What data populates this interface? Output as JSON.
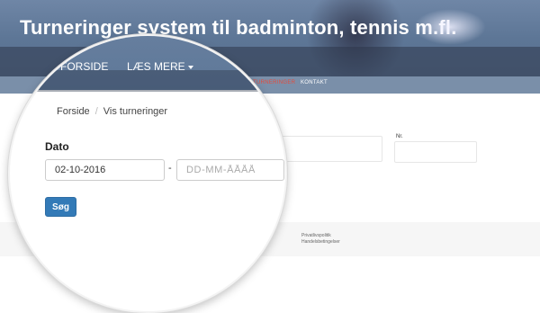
{
  "header": {
    "title": "Turneringer system til badminton, tennis m.fl."
  },
  "nav": {
    "items": [
      "FORSIDE",
      "LÆS MERE"
    ]
  },
  "subnav": {
    "items": [
      "TURNERINGER",
      "KONTAKT"
    ]
  },
  "breadcrumb": {
    "home": "Forside",
    "current": "Vis turneringer"
  },
  "form": {
    "date_label": "Dato",
    "date_from_value": "02-10-2016",
    "date_to_placeholder": "DD-MM-ÅÅÅÅ",
    "range_separator": "-",
    "nr_label": "Nr.",
    "search_button": "Søg"
  },
  "footer": {
    "links": [
      "Privatlivspolitik",
      "Handelsbetingelser"
    ]
  }
}
